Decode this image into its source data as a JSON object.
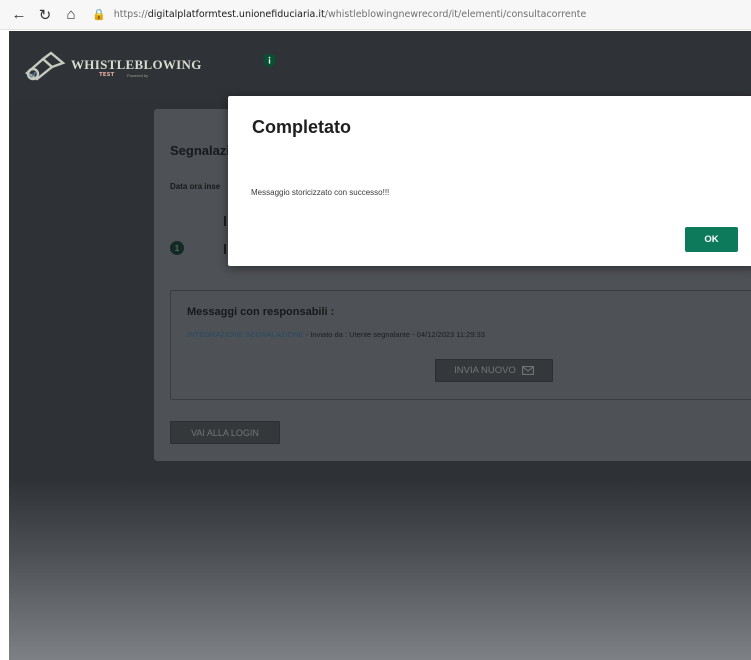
{
  "browser": {
    "back_icon": "back-arrow-icon",
    "reload_icon": "reload-icon",
    "home_icon": "home-icon",
    "url_scheme": "https://",
    "url_host": "digitalplatformtest.unionefiduciaria.it",
    "url_path": "/whistleblowingnewrecord/it/elementi/consultacorrente"
  },
  "header": {
    "brand_title": "WHISTLEBLOWING",
    "brand_sub": "TEST",
    "brand_powered": "Powered by ",
    "shield_icon": "shield-info-icon"
  },
  "card": {
    "title": "Segnalazi",
    "date_label": "Data ora inse",
    "step_number": "1",
    "messages": {
      "title": "Messaggi con responsabili :",
      "link_text": "INTEGRAZIONE SEGNALAZIONE",
      "line_rest": " - Inviato da : Utente segnalante - 04/12/2023 11:29:33",
      "send_new_label": "INVIA NUOVO"
    },
    "login_label": "VAI ALLA LOGIN"
  },
  "modal": {
    "title": "Completato",
    "body": "Messaggio storicizzato con successo!!!",
    "ok_label": "OK"
  },
  "colors": {
    "accent_ok": "#0c7a5b",
    "header_bg": "#2f3236",
    "link": "#284a66"
  }
}
